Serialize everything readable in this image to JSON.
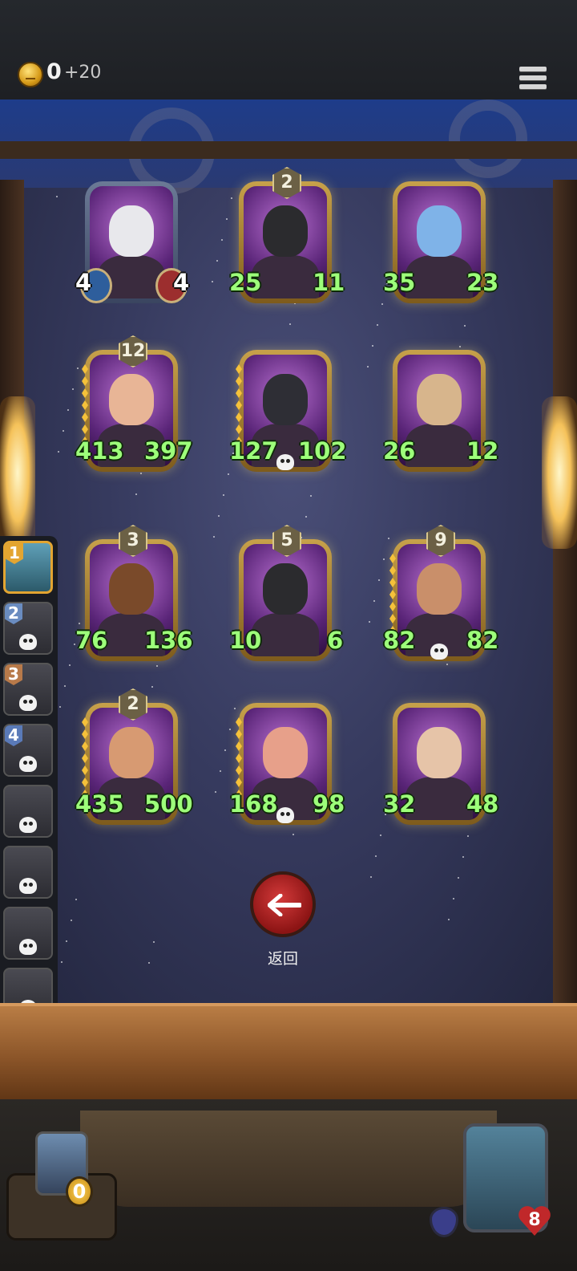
{
  "header": {
    "gold": "0",
    "gold_income": "+20"
  },
  "board": {
    "cards": [
      {
        "atk": "4",
        "hp": "4",
        "level": "",
        "frame": "blue",
        "skin": "#e8e8ec"
      },
      {
        "atk": "25",
        "hp": "11",
        "level": "2",
        "frame": "gold",
        "skin": "#2b2b2e"
      },
      {
        "atk": "35",
        "hp": "23",
        "level": "",
        "frame": "gold",
        "skin": "#7fb3e8"
      },
      {
        "atk": "413",
        "hp": "397",
        "level": "12",
        "frame": "gold",
        "skin": "#e8b596"
      },
      {
        "atk": "127",
        "hp": "102",
        "level": "",
        "frame": "gold",
        "skin": "#2e2e35"
      },
      {
        "atk": "26",
        "hp": "12",
        "level": "",
        "frame": "gold",
        "skin": "#d7b58c"
      },
      {
        "atk": "76",
        "hp": "136",
        "level": "3",
        "frame": "gold",
        "skin": "#7a4a2a"
      },
      {
        "atk": "10",
        "hp": "6",
        "level": "5",
        "frame": "gold",
        "skin": "#2b2b2e"
      },
      {
        "atk": "82",
        "hp": "82",
        "level": "9",
        "frame": "gold",
        "skin": "#c98f6a"
      },
      {
        "atk": "435",
        "hp": "500",
        "level": "2",
        "frame": "gold",
        "skin": "#d79a72"
      },
      {
        "atk": "168",
        "hp": "98",
        "level": "",
        "frame": "gold",
        "skin": "#e7a08a"
      },
      {
        "atk": "32",
        "hp": "48",
        "level": "",
        "frame": "gold",
        "skin": "#e6c4a8"
      }
    ]
  },
  "sidebar": {
    "slots": [
      {
        "rank": "1"
      },
      {
        "rank": "2"
      },
      {
        "rank": "3"
      },
      {
        "rank": "4"
      },
      {
        "rank": ""
      },
      {
        "rank": ""
      },
      {
        "rank": ""
      },
      {
        "rank": ""
      }
    ]
  },
  "actions": {
    "back_label": "返回"
  },
  "player": {
    "gold": "0",
    "health": "8"
  }
}
